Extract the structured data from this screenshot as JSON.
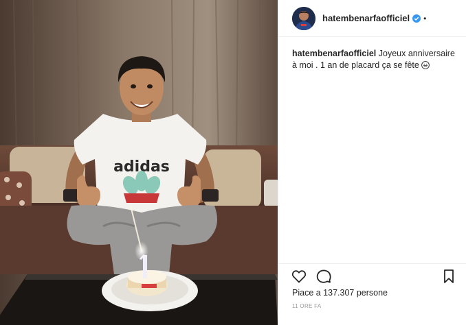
{
  "post": {
    "username": "hatembenarfaofficiel",
    "verified_icon": "verified-badge-icon",
    "separator": "•",
    "caption_user": "hatembenarfaofficiel",
    "caption_text": " Joyeux anniversaire à moi . 1 an de placard ça se fête ",
    "caption_emoji": "grinning-face-emoji",
    "likes": "Piace a 137.307 persone",
    "time": "11 ORE FA",
    "shirt_text": "adidas"
  },
  "icons": {
    "like": "heart-icon",
    "comment": "comment-icon",
    "save": "bookmark-icon"
  },
  "colors": {
    "verified": "#3897f0",
    "text": "#262626",
    "muted": "#999999",
    "border": "#efefef"
  }
}
